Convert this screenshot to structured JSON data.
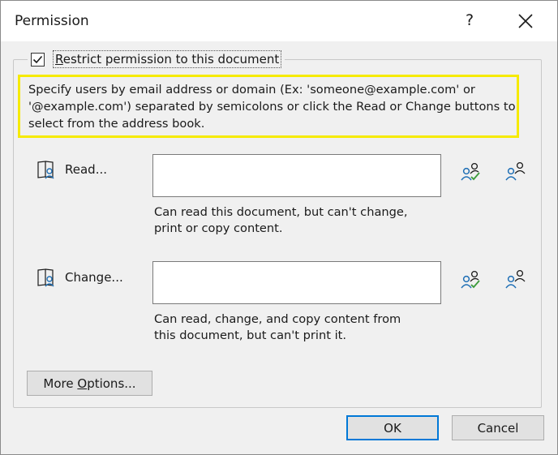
{
  "dialog": {
    "title": "Permission",
    "help_glyph": "?",
    "close_icon": "close-icon"
  },
  "restrict": {
    "checked": true,
    "label_accel": "R",
    "label_rest": "estrict permission to this document"
  },
  "info_text": "Specify users by email address or domain (Ex: 'someone@example.com' or '@example.com') separated by semicolons or click the Read or Change buttons to select from the address book.",
  "read": {
    "label": "Read...",
    "value": "",
    "description_line1": "Can read this document, but can't change,",
    "description_line2": "print or copy content."
  },
  "change": {
    "label": "Change...",
    "value": "",
    "description_line1": "Can read, change, and copy content from",
    "description_line2": "this document, but can't print it."
  },
  "buttons": {
    "more_options_pre": "More ",
    "more_options_accel": "O",
    "more_options_post": "ptions...",
    "ok": "OK",
    "cancel": "Cancel"
  },
  "colors": {
    "highlight_border": "#f6ea00",
    "icon_blue": "#1f6fb5",
    "icon_green": "#3a9a3a",
    "default_button_border": "#0078d7"
  }
}
